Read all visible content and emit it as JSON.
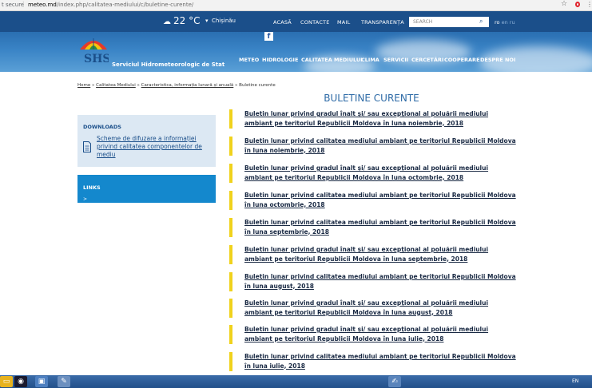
{
  "browser": {
    "security": "t secure",
    "domain": "meteo.md",
    "path": "/index.php/calitatea-mediului/c/buletine-curente/"
  },
  "topbar": {
    "temperature": "22 °C",
    "city": "Chișinău",
    "links": [
      "ACASĂ",
      "CONTACTE",
      "MAIL",
      "TRANSPARENȚA"
    ],
    "search_placeholder": "SEARCH",
    "lang_active": "ro",
    "lang_other": "en ru"
  },
  "header": {
    "site_name": "Serviciul Hidrometeorologic de Stat",
    "nav": [
      "METEO",
      "HIDROLOGIE",
      "CALITATEA MEDIULUI",
      "CLIMA",
      "SERVICII",
      "CERCETĂRI",
      "COOPERARE",
      "DESPRE NOI"
    ]
  },
  "breadcrumb": {
    "home": "Home",
    "sep": "»",
    "item1": "Calitatea Mediului",
    "item2": "Caracteristica, informația lunară și anuală",
    "current": "Buletine curente"
  },
  "page_title": "BULETINE CURENTE",
  "sidebar": {
    "downloads_title": "DOWNLOADS",
    "downloads_link": "Scheme de difuzare a informației privind calitatea componentelor de mediu",
    "links_title": "LINKS",
    "links_arrow": ">"
  },
  "bulletins": [
    " Buletin lunar privind gradul înalt şi/ sau excepţional al poluării mediului ambiant pe teritoriul Republicii Moldova în luna noiembrie, 2018 ",
    " Buletin lunar privind calitatea mediului ambiant pe teritoriul Republicii Moldova în luna noiembrie, 2018",
    "Buletin lunar privind gradul înalt şi/ sau excepţional al poluării mediului ambiant pe teritoriul Republicii Moldova în luna octombrie, 2018 ",
    " Buletin lunar privind calitatea mediului ambiant pe teritoriul Republicii Moldova în luna octombrie, 2018",
    "Buletin lunar privind calitatea mediului ambiant pe teritoriul Republicii Moldova în luna septembrie, 2018 ",
    "Buletin lunar privind gradul înalt şi/ sau excepţional al poluării mediului ambiant pe teritoriul Republicii Moldova în luna septembrie, 2018 ",
    " Buletin lunar privind calitatea mediului ambiant pe teritoriul Republicii Moldova în luna august, 2018",
    " Buletin lunar privind  gradul înalt şi/ sau excepţional al poluării mediului ambiant pe teritoriul Republicii Moldova în luna august, 2018",
    "Buletin lunar privind  gradul înalt şi/ sau excepţional al poluării mediului ambiant pe teritoriul Republicii Moldova în luna iulie, 2018 ",
    " Buletin lunar privind calitatea mediului ambiant pe teritoriul Republicii Moldova în luna iulie, 2018"
  ],
  "taskbar": {
    "lang": "EN"
  },
  "colors": {
    "topbar": "#1b4f8a",
    "accent": "#2d6aa6",
    "bulletin_bar": "#f0d21c",
    "links_box": "#1488cd"
  }
}
